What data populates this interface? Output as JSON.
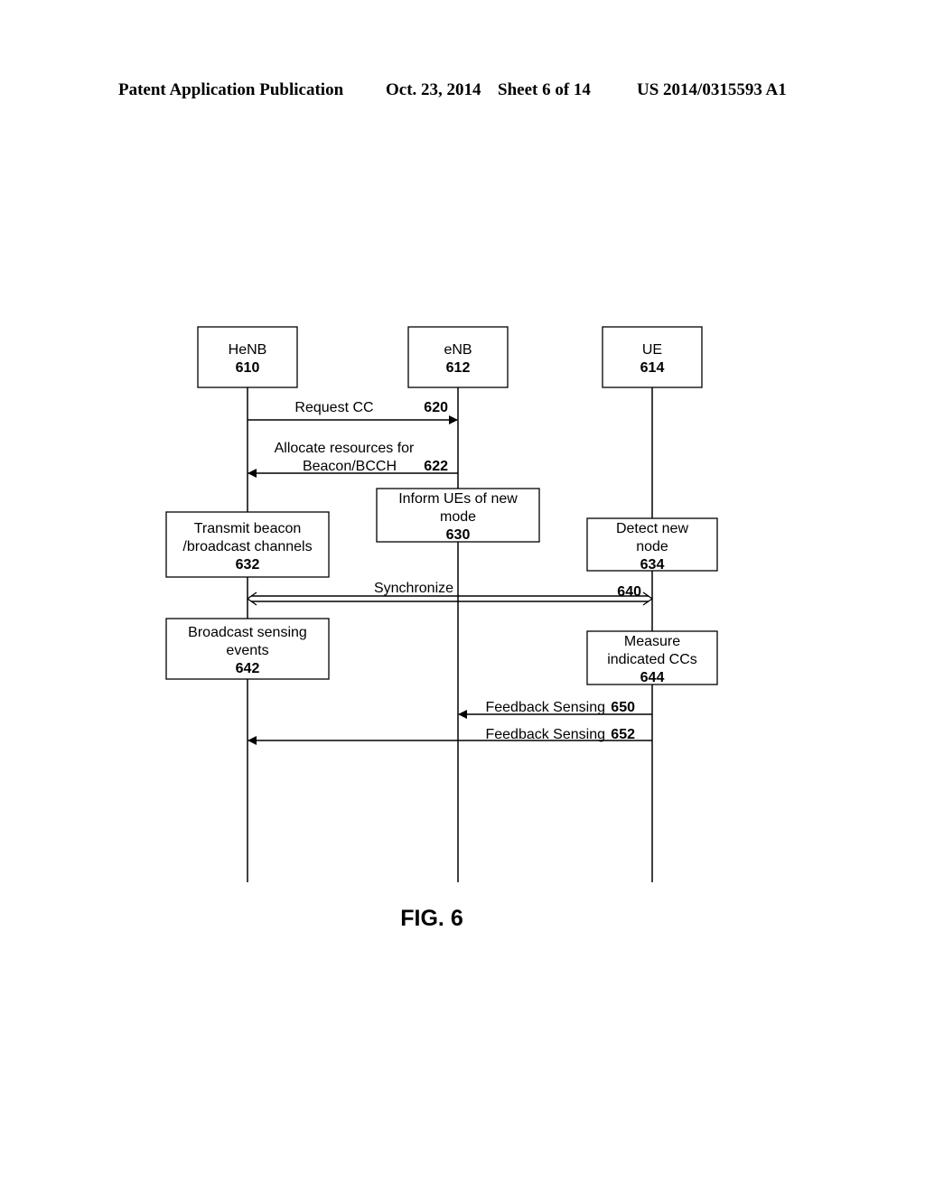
{
  "header": {
    "publication": "Patent Application Publication",
    "date": "Oct. 23, 2014",
    "sheet": "Sheet 6 of 14",
    "number": "US 2014/0315593 A1"
  },
  "entities": [
    {
      "name": "HeNB",
      "ref": "610"
    },
    {
      "name": "eNB",
      "ref": "612"
    },
    {
      "name": "UE",
      "ref": "614"
    }
  ],
  "messages": {
    "request_cc": {
      "label": "Request CC",
      "ref": "620",
      "from": "HeNB",
      "to": "eNB"
    },
    "allocate": {
      "label_line1": "Allocate resources for",
      "label_line2": "Beacon/BCCH",
      "ref": "622",
      "from": "eNB",
      "to": "HeNB"
    },
    "synchronize": {
      "label": "Synchronize",
      "ref": "640",
      "from": "HeNB",
      "to": "UE",
      "bidirectional": true
    },
    "feedback_650": {
      "label": "Feedback Sensing",
      "ref": "650",
      "from": "UE",
      "to": "eNB"
    },
    "feedback_652": {
      "label": "Feedback Sensing",
      "ref": "652",
      "from": "UE",
      "to": "HeNB"
    }
  },
  "actions": {
    "inform_ues": {
      "line1": "Inform UEs of new",
      "line2": "mode",
      "ref": "630"
    },
    "transmit_beacon": {
      "line1": "Transmit beacon",
      "line2": "/broadcast channels",
      "ref": "632"
    },
    "detect_node": {
      "line1": "Detect new",
      "line2": "node",
      "ref": "634"
    },
    "broadcast_sensing": {
      "line1": "Broadcast sensing",
      "line2": "events",
      "ref": "642"
    },
    "measure_ccs": {
      "line1": "Measure",
      "line2": "indicated CCs",
      "ref": "644"
    }
  },
  "figure_label": "FIG. 6"
}
